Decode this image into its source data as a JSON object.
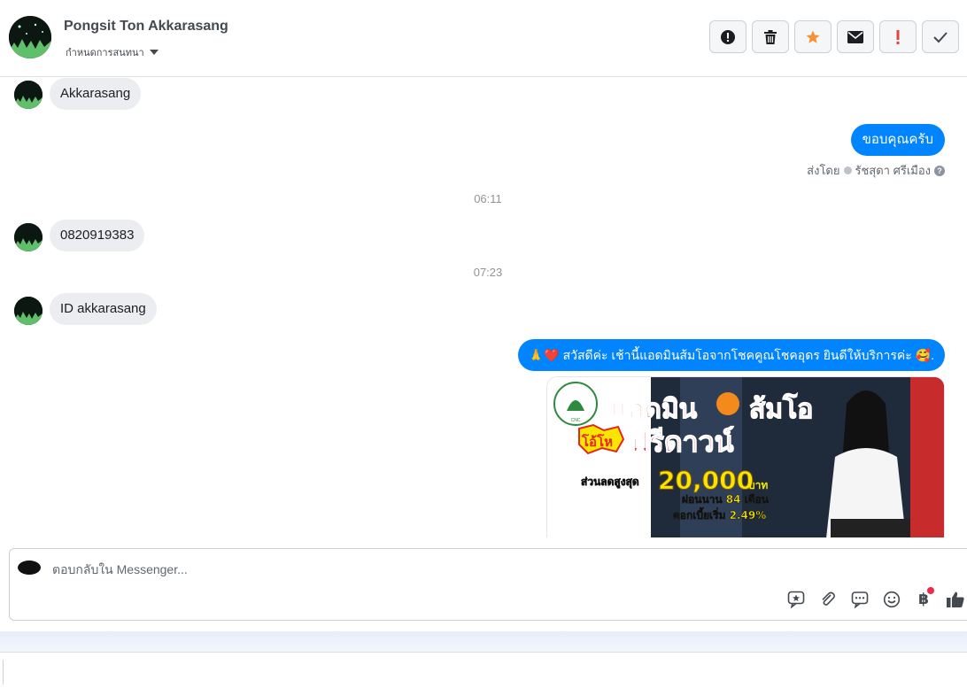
{
  "header": {
    "contact_name": "Pongsit Ton Akkarasang",
    "assign_label": "กำหนดการสนทนา",
    "actions": [
      {
        "name": "report-button",
        "icon": "exclamation-circle-icon"
      },
      {
        "name": "delete-button",
        "icon": "trash-icon"
      },
      {
        "name": "star-button",
        "icon": "star-icon",
        "color": "#f7923b"
      },
      {
        "name": "mark-unread-button",
        "icon": "envelope-icon"
      },
      {
        "name": "priority-button",
        "icon": "exclamation-icon",
        "color": "#e4453a"
      },
      {
        "name": "done-button",
        "icon": "check-icon"
      }
    ]
  },
  "messages": {
    "m1": "Akkarasang",
    "m2": "ขอบคุณครับ",
    "sent_by_prefix": "ส่งโดย",
    "sent_by_name": "รัชสุดา ศรีเมือง",
    "t1": "06:11",
    "m3": "0820919383",
    "t2": "07:23",
    "m4": "ID akkarasang",
    "m5_emoji_pre": "🙏❤️",
    "m5_text": "สวัสดีค่ะ เช้านี้แอดมินส้มโอจากโชคคูณโชคอุดร ยินดีให้บริการค่ะ",
    "m5_emoji_post": "🥰."
  },
  "promo": {
    "line1": "แอดมิน",
    "line1b": "ส้มโอ",
    "tag": "โอ้โห",
    "headline": "ฟรีดาวน์",
    "discount_label": "ส่วนลดสูงสุด",
    "discount_value": "20,000",
    "currency": "บาท",
    "installment": "ผ่อนนาน 84 เดือน",
    "interest": "ดอกเบี้ยเริ่ม 2.49%"
  },
  "composer": {
    "placeholder": "ตอบกลับใน Messenger...",
    "tools": [
      "saved-reply-icon",
      "attachment-icon",
      "quick-reply-icon",
      "emoji-icon",
      "baht-payment-icon",
      "like-icon"
    ]
  },
  "colors": {
    "accent": "#0084ff",
    "bubble_in": "#ebedf0"
  }
}
